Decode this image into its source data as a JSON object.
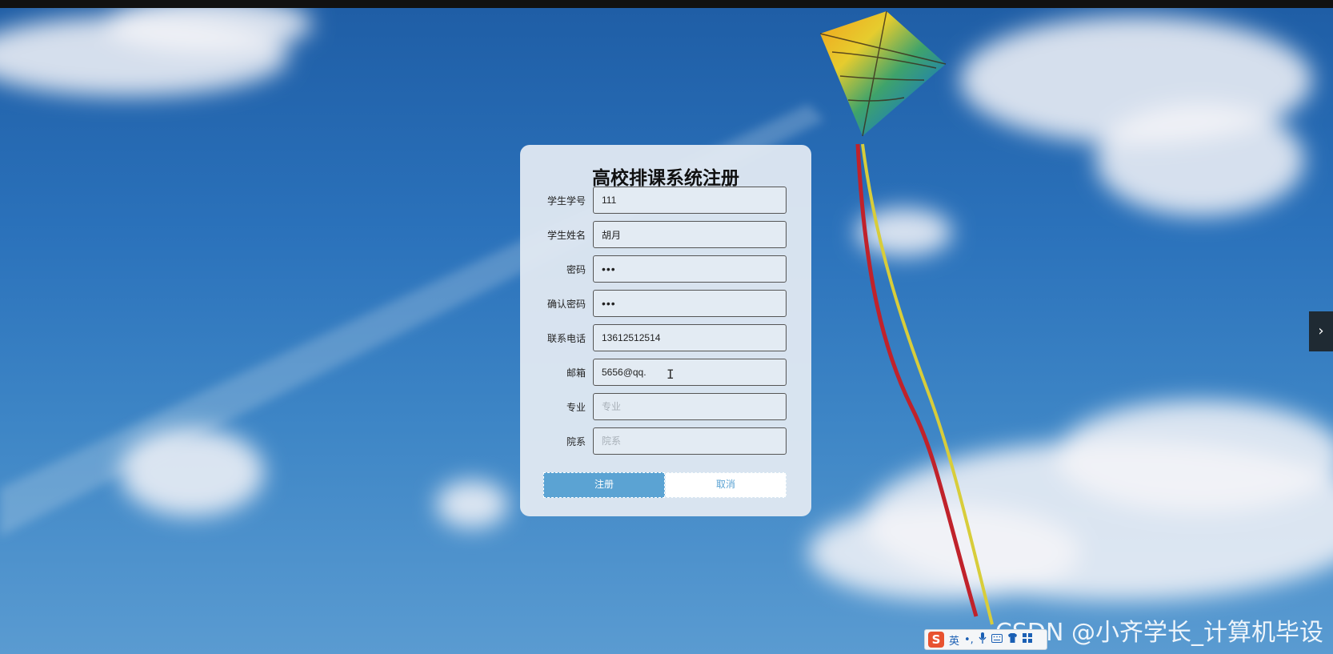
{
  "form": {
    "title": "高校排课系统注册",
    "fields": [
      {
        "label": "学生学号",
        "value": "111",
        "placeholder": "",
        "type": "text"
      },
      {
        "label": "学生姓名",
        "value": "胡月",
        "placeholder": "",
        "type": "text"
      },
      {
        "label": "密码",
        "value": "•••",
        "placeholder": "",
        "type": "password"
      },
      {
        "label": "确认密码",
        "value": "•••",
        "placeholder": "",
        "type": "password"
      },
      {
        "label": "联系电话",
        "value": "13612512514",
        "placeholder": "",
        "type": "text"
      },
      {
        "label": "邮箱",
        "value": "5656@qq.",
        "placeholder": "",
        "type": "text"
      },
      {
        "label": "专业",
        "value": "",
        "placeholder": "专业",
        "type": "text"
      },
      {
        "label": "院系",
        "value": "",
        "placeholder": "院系",
        "type": "text"
      }
    ],
    "register_label": "注册",
    "cancel_label": "取消"
  },
  "side_toggle": {
    "icon": "chevron-right-icon",
    "glyph": "›"
  },
  "watermark": "CSDN @小齐学长_计算机毕设",
  "ime_toolbar": {
    "logo": "S",
    "mode": "英",
    "icons": [
      "punctuation-icon",
      "microphone-icon",
      "keyboard-icon",
      "skin-icon",
      "toolbox-icon"
    ]
  },
  "colors": {
    "primary": "#5ba3d3",
    "sky": "#2b72bb",
    "card": "#e2eaf2"
  }
}
